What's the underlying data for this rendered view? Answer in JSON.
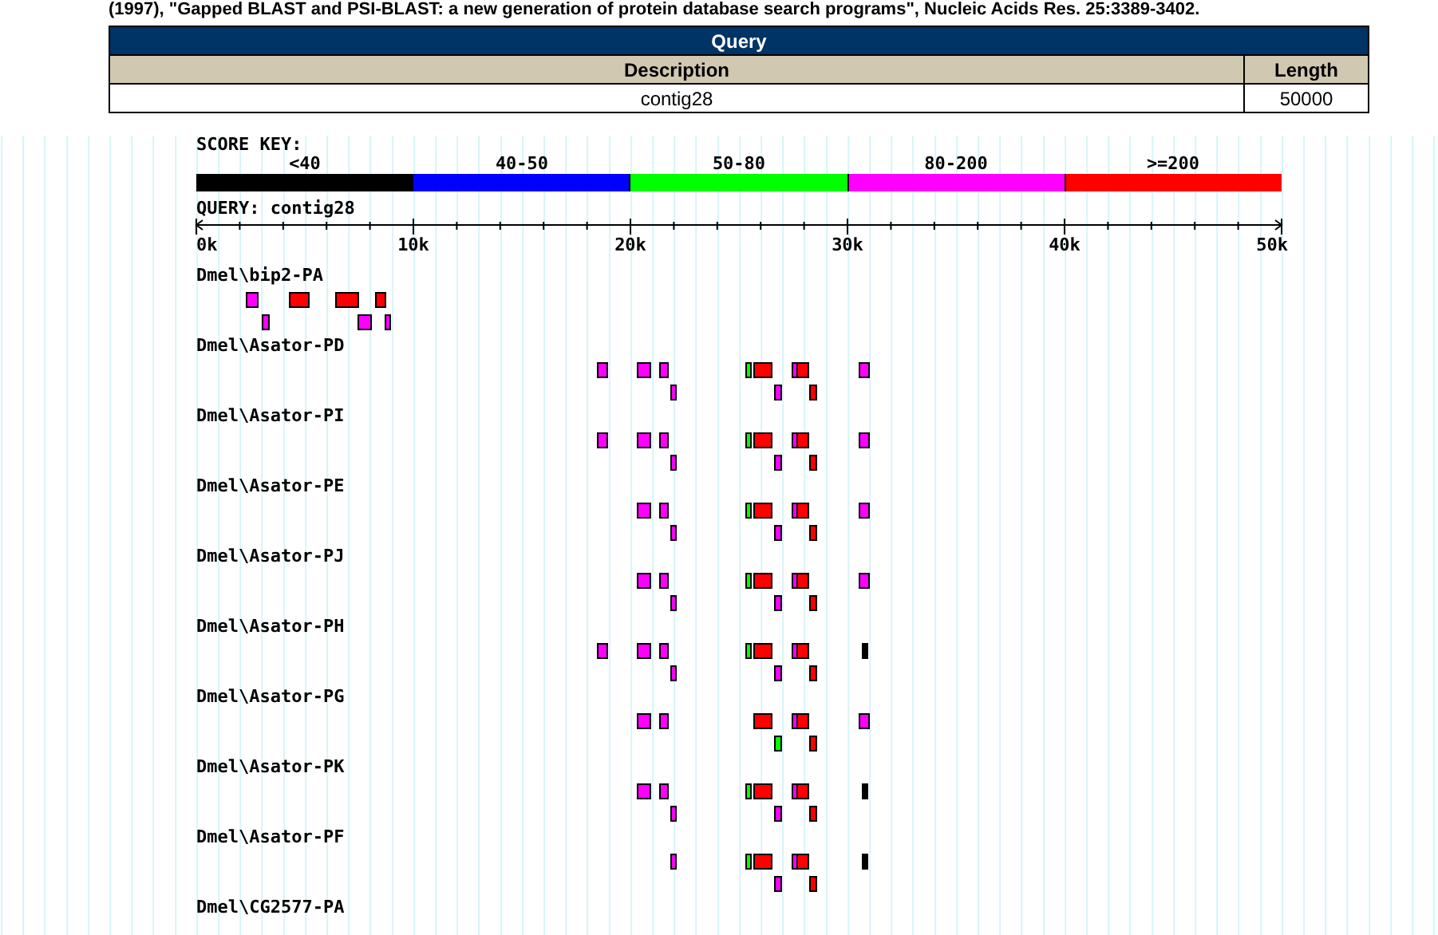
{
  "citation": "(1997), \"Gapped BLAST and PSI-BLAST: a new generation of protein database search programs\", Nucleic Acids Res. 25:3389-3402.",
  "query_table": {
    "title": "Query",
    "columns": [
      "Description",
      "Length"
    ],
    "row": [
      "contig28",
      "50000"
    ]
  },
  "score_key": {
    "label": "SCORE KEY:",
    "ranges": [
      {
        "label": "<40",
        "color": "#000000"
      },
      {
        "label": "40-50",
        "color": "#0000ff"
      },
      {
        "label": "50-80",
        "color": "#00ff00"
      },
      {
        "label": "80-200",
        "color": "#ff00ff"
      },
      {
        "label": ">=200",
        "color": "#ff0000"
      }
    ]
  },
  "query_label": "QUERY: contig28",
  "axis_labels": [
    "0k",
    "10k",
    "20k",
    "30k",
    "40k",
    "50k"
  ],
  "sequences": [
    {
      "name": "Dmel\\bip2-PA",
      "rows": [
        {
          "hits": [
            {
              "color": "#ff00ff"
            },
            {
              "color": "#ff0000"
            },
            {
              "color": "#ff0000"
            },
            {
              "color": "#ff0000"
            }
          ]
        },
        {
          "hits": [
            {
              "color": "#ff00ff"
            },
            {
              "color": "#ff00ff"
            },
            {
              "color": "#ff00ff"
            }
          ]
        }
      ]
    },
    {
      "name": "Dmel\\Asator-PD",
      "rows": [
        {
          "hits": [
            {
              "color": "#ff00ff"
            },
            {
              "color": "#ff00ff"
            },
            {
              "color": "#ff00ff"
            },
            {
              "color": "#00ff00"
            },
            {
              "color": "#ff0000"
            },
            {
              "color": "#ff00ff"
            },
            {
              "color": "#ff0000"
            },
            {
              "color": "#ff00ff"
            }
          ]
        },
        {
          "hits": [
            {
              "color": "#ff00ff"
            },
            {
              "color": "#ff00ff"
            },
            {
              "color": "#ff0000"
            }
          ]
        }
      ]
    },
    {
      "name": "Dmel\\Asator-PI",
      "rows": [
        {
          "hits": [
            {
              "color": "#ff00ff"
            },
            {
              "color": "#ff00ff"
            },
            {
              "color": "#ff00ff"
            },
            {
              "color": "#00ff00"
            },
            {
              "color": "#ff0000"
            },
            {
              "color": "#ff00ff"
            },
            {
              "color": "#ff0000"
            },
            {
              "color": "#ff00ff"
            }
          ]
        },
        {
          "hits": [
            {
              "color": "#ff00ff"
            },
            {
              "color": "#ff00ff"
            },
            {
              "color": "#ff0000"
            }
          ]
        }
      ]
    },
    {
      "name": "Dmel\\Asator-PE",
      "rows": [
        {
          "hits": [
            {
              "color": "#ff00ff"
            },
            {
              "color": "#ff00ff"
            },
            {
              "color": "#00ff00"
            },
            {
              "color": "#ff0000"
            },
            {
              "color": "#ff00ff"
            },
            {
              "color": "#ff0000"
            },
            {
              "color": "#ff00ff"
            }
          ]
        },
        {
          "hits": [
            {
              "color": "#ff00ff"
            },
            {
              "color": "#ff00ff"
            },
            {
              "color": "#ff0000"
            }
          ]
        }
      ]
    },
    {
      "name": "Dmel\\Asator-PJ",
      "rows": [
        {
          "hits": [
            {
              "color": "#ff00ff"
            },
            {
              "color": "#ff00ff"
            },
            {
              "color": "#00ff00"
            },
            {
              "color": "#ff0000"
            },
            {
              "color": "#ff00ff"
            },
            {
              "color": "#ff0000"
            },
            {
              "color": "#ff00ff"
            }
          ]
        },
        {
          "hits": [
            {
              "color": "#ff00ff"
            },
            {
              "color": "#ff00ff"
            },
            {
              "color": "#ff0000"
            }
          ]
        }
      ]
    },
    {
      "name": "Dmel\\Asator-PH",
      "rows": [
        {
          "hits": [
            {
              "color": "#ff00ff"
            },
            {
              "color": "#ff00ff"
            },
            {
              "color": "#ff00ff"
            },
            {
              "color": "#00ff00"
            },
            {
              "color": "#ff0000"
            },
            {
              "color": "#ff00ff"
            },
            {
              "color": "#ff0000"
            },
            {
              "color": "#000000"
            }
          ]
        },
        {
          "hits": [
            {
              "color": "#ff00ff"
            },
            {
              "color": "#ff00ff"
            },
            {
              "color": "#ff0000"
            }
          ]
        }
      ]
    },
    {
      "name": "Dmel\\Asator-PG",
      "rows": [
        {
          "hits": [
            {
              "color": "#ff00ff"
            },
            {
              "color": "#ff00ff"
            },
            {
              "color": "#ff0000"
            },
            {
              "color": "#ff00ff"
            },
            {
              "color": "#ff0000"
            },
            {
              "color": "#ff00ff"
            }
          ]
        },
        {
          "hits": [
            {
              "color": "#00ff00"
            },
            {
              "color": "#ff0000"
            }
          ]
        }
      ]
    },
    {
      "name": "Dmel\\Asator-PK",
      "rows": [
        {
          "hits": [
            {
              "color": "#ff00ff"
            },
            {
              "color": "#ff00ff"
            },
            {
              "color": "#00ff00"
            },
            {
              "color": "#ff0000"
            },
            {
              "color": "#ff00ff"
            },
            {
              "color": "#ff0000"
            },
            {
              "color": "#000000"
            }
          ]
        },
        {
          "hits": [
            {
              "color": "#ff00ff"
            },
            {
              "color": "#ff00ff"
            },
            {
              "color": "#ff0000"
            }
          ]
        }
      ]
    },
    {
      "name": "Dmel\\Asator-PF",
      "rows": [
        {
          "hits": [
            {
              "color": "#ff00ff"
            },
            {
              "color": "#00ff00"
            },
            {
              "color": "#ff0000"
            },
            {
              "color": "#ff00ff"
            },
            {
              "color": "#ff0000"
            },
            {
              "color": "#000000"
            }
          ]
        },
        {
          "hits": [
            {
              "color": "#ff00ff"
            },
            {
              "color": "#ff0000"
            }
          ]
        }
      ]
    },
    {
      "name": "Dmel\\CG2577-PA"
    }
  ]
}
